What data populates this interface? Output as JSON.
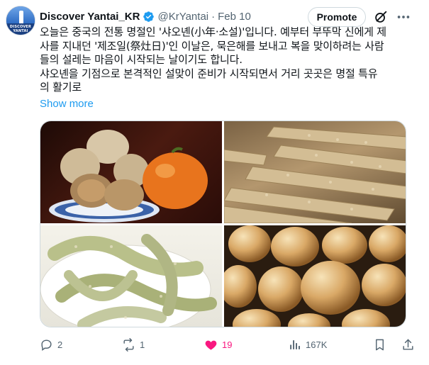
{
  "tweet": {
    "author_name": "Discover Yantai_KR",
    "handle": "@KrYantai",
    "separator": "·",
    "date": "Feb 10",
    "avatar_text": "DISCOVER YANTAI",
    "text_lines": [
      "오늘은 중국의 전통 명절인 '샤오녠(小年·소설)'입니다. 예부터 부뚜막 신에게 제",
      "사를 지내던 '제조일(祭灶日)'인 이날은, 묵은해를 보내고 복을 맞이하려는 사람",
      "들의 설레는 마음이 시작되는 날이기도 합니다.",
      "샤오녠을 기점으로 본격적인 설맞이 준비가 시작되면서 거리 곳곳은 명절 특유",
      "의 활기로"
    ],
    "show_more": "Show more",
    "promote_label": "Promote"
  },
  "media": {
    "images": [
      {
        "name": "dried-round-snacks-and-persimmon-photo"
      },
      {
        "name": "sesame-sticks-photo"
      },
      {
        "name": "sesame-coated-sweets-plate-photo"
      },
      {
        "name": "golden-round-candies-photo"
      }
    ]
  },
  "actions": {
    "replies": "2",
    "reposts": "1",
    "likes": "19",
    "views": "167K"
  },
  "colors": {
    "accent": "#1d9bf0",
    "like": "#f91880",
    "muted": "#536471",
    "text": "#0f1419"
  }
}
